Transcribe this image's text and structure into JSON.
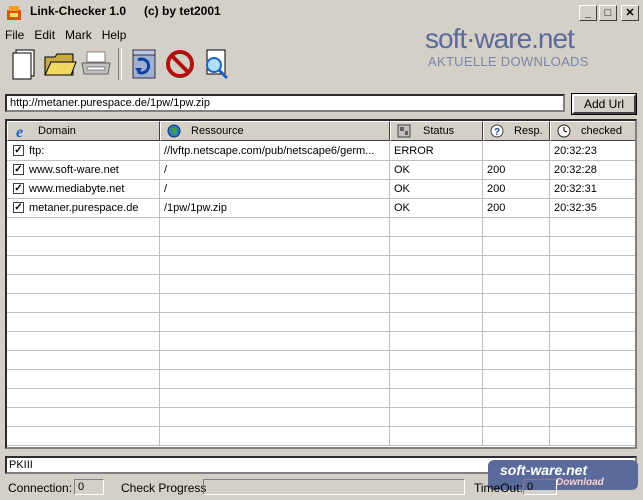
{
  "window": {
    "app_name": "Link-Checker 1.0",
    "by_line": "(c) by tet2001",
    "minimize": "_",
    "maximize": "□",
    "close": "✕"
  },
  "menu": [
    "File",
    "Edit",
    "Mark",
    "Help"
  ],
  "toolbar": {
    "icons": [
      "new-document-icon",
      "open-folder-icon",
      "print-icon",
      "refresh-icon",
      "stop-icon",
      "check-link-icon"
    ]
  },
  "brand": {
    "name": "soft·ware.net",
    "tagline": "AKTUELLE DOWNLOADS"
  },
  "url_bar": {
    "value": "http://metaner.purespace.de/1pw/1pw.zip",
    "add_button": "Add Url"
  },
  "table": {
    "columns": [
      "Domain",
      "Ressource",
      "Status",
      "Resp.",
      "checked"
    ],
    "rows": [
      {
        "checked": true,
        "domain": "ftp:",
        "resource": "//lvftp.netscape.com/pub/netscape6/germ...",
        "status": "ERROR",
        "resp": "",
        "time": "20:32:23"
      },
      {
        "checked": true,
        "domain": "www.soft-ware.net",
        "resource": "/",
        "status": "OK",
        "resp": "200",
        "time": "20:32:28"
      },
      {
        "checked": true,
        "domain": "www.mediabyte.net",
        "resource": "/",
        "status": "OK",
        "resp": "200",
        "time": "20:32:31"
      },
      {
        "checked": true,
        "domain": "metaner.purespace.de",
        "resource": "/1pw/1pw.zip",
        "status": "OK",
        "resp": "200",
        "time": "20:32:35"
      }
    ]
  },
  "status_input": "PKIII",
  "statusbar": {
    "connection_label": "Connection:",
    "connection_value": "0",
    "progress_label": "Check Progress",
    "progress": 0,
    "timeout_label": "TimeOut:",
    "timeout_value": "0"
  },
  "watermark": {
    "name": "soft-ware.net",
    "sub": "Download"
  },
  "colors": {
    "accent": "#5a6a9a",
    "window_bg": "#d4d0c8"
  }
}
